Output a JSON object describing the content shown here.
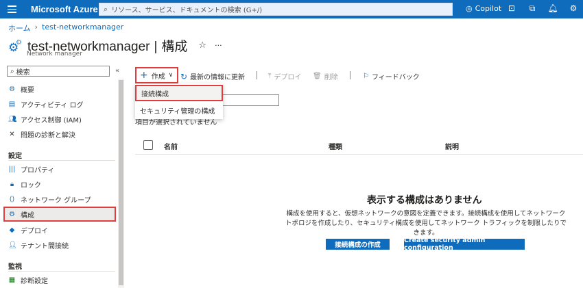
{
  "topbar": {
    "brand": "Microsoft Azure",
    "search_placeholder": "リソース、サービス、ドキュメントの検索 (G+/)",
    "copilot": "Copilot",
    "icons": [
      "terminal-icon",
      "feedback-filter-icon",
      "bell-icon",
      "gear-icon"
    ]
  },
  "breadcrumb": {
    "home": "ホーム",
    "current": "test-networkmanager"
  },
  "header": {
    "resource": "test-networkmanager",
    "separator": "|",
    "page": "構成",
    "subtitle": "Network manager"
  },
  "sidebar": {
    "search_label": "検索",
    "collapse": "«",
    "items_top": [
      "概要",
      "アクティビティ ログ",
      "アクセス制御 (IAM)",
      "問題の診断と解決"
    ],
    "section_settings": "設定",
    "items_settings": [
      "プロパティ",
      "ロック",
      "ネットワーク グループ",
      "構成",
      "デプロイ",
      "テナント間接続"
    ],
    "section_monitor": "監視",
    "items_monitor": [
      "診断設定"
    ]
  },
  "toolbar": {
    "create": "作成",
    "refresh": "最新の情報に更新",
    "deploy": "デプロイ",
    "delete": "削除",
    "feedback": "フィードバック"
  },
  "dropdown": {
    "items": [
      "接続構成",
      "セキュリティ管理の構成"
    ]
  },
  "list": {
    "no_selection": "項目が選択されていません",
    "columns": [
      "名前",
      "種類",
      "説明"
    ]
  },
  "empty": {
    "title": "表示する構成はありません",
    "description": "構成を使用すると、仮想ネットワークの意図を定義できます。接続構成を使用してネットワーク トポロジを作成したり、セキュリティ構成を使用してネットワーク トラフィックを制限したりできます。",
    "btn_connectivity": "接続構成の作成",
    "btn_security": "Create security admin configuration"
  },
  "colors": {
    "azure_blue": "#0f6cbd",
    "highlight_red": "#e03e3e"
  }
}
